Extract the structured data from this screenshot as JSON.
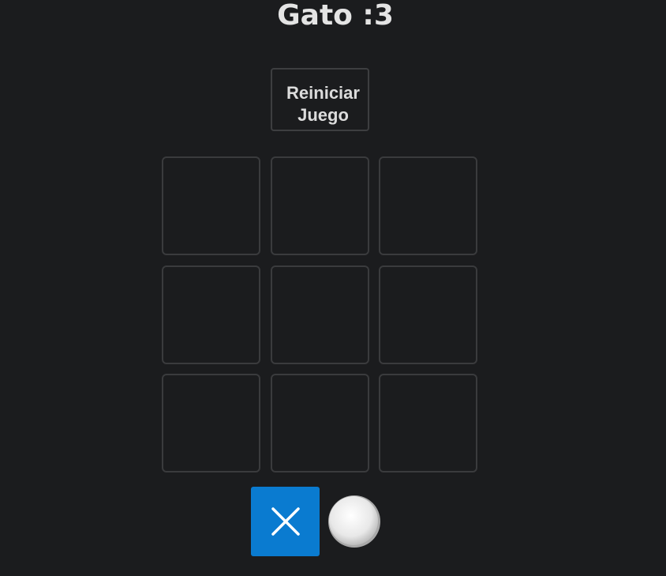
{
  "title": "Gato :3",
  "reset_button": {
    "line1": "Reiniciar",
    "line2": "Juego"
  },
  "board": {
    "cells": [
      "",
      "",
      "",
      "",
      "",
      "",
      "",
      "",
      ""
    ]
  },
  "turn_indicator": {
    "x_icon": "close-x-icon",
    "o_icon": "white-circle-icon",
    "active": "X",
    "active_color": "#0a7bd0"
  }
}
